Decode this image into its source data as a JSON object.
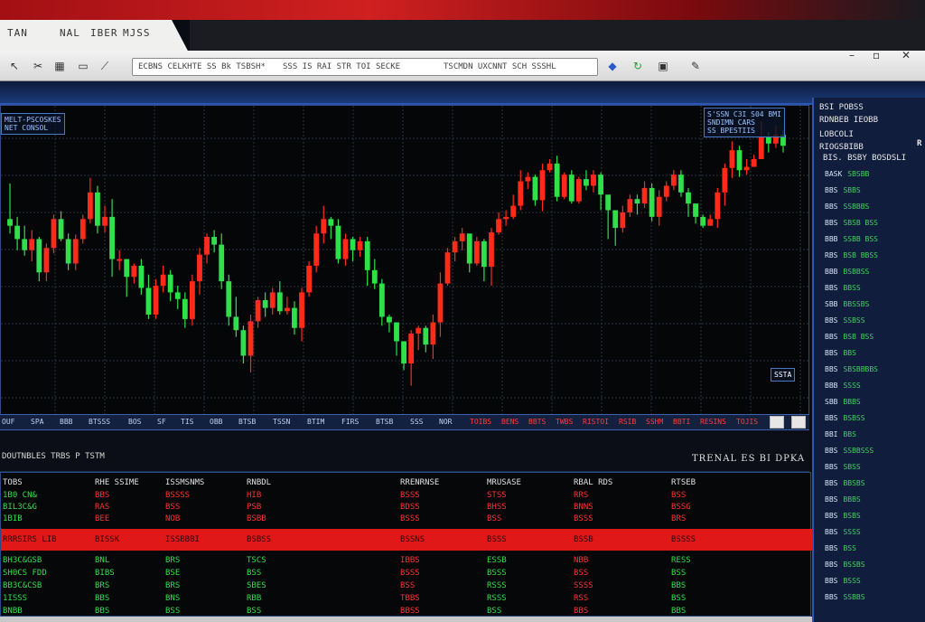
{
  "colors": {
    "up": "#2fe04a",
    "down": "#ff2a1a",
    "grid": "#2b3142",
    "accent": "#2d56b0"
  },
  "menu": {
    "items": [
      "TAN",
      "NAL",
      "IBER",
      "MJSS"
    ]
  },
  "toolbar": {
    "address_part1": "ECBNS CELKHTE SS Bk TSBSH*",
    "address_part2": "SSS IS RAI STR TOI SECKE",
    "address_part3": "TSCMDN UXCNNT SCH SSSHL",
    "icons": [
      "cursor-icon",
      "scissors-icon",
      "chart-icon",
      "image-icon",
      "line-icon",
      "bookmark-icon",
      "refresh-icon",
      "camera-icon",
      "pen-icon"
    ],
    "window_buttons": [
      "–",
      "▫",
      "✕"
    ]
  },
  "chart_data": {
    "type": "candlestick",
    "overlay_top_left": [
      "MELT-PSCOSKES",
      "NET CONSOL"
    ],
    "overlay_top_right": [
      "S'SSN C3I S04 BMI",
      "SNDIMN CARS",
      "SS BPESTIIS"
    ],
    "price_tag": "SSTA",
    "candles": [
      [
        318,
        312,
        350,
        305
      ],
      [
        312,
        300,
        320,
        290
      ],
      [
        300,
        290,
        312,
        285
      ],
      [
        290,
        300,
        308,
        280
      ],
      [
        300,
        270,
        302,
        262
      ],
      [
        270,
        292,
        296,
        262
      ],
      [
        292,
        318,
        322,
        287
      ],
      [
        318,
        300,
        325,
        298
      ],
      [
        300,
        278,
        305,
        272
      ],
      [
        278,
        300,
        304,
        272
      ],
      [
        300,
        318,
        322,
        296
      ],
      [
        318,
        342,
        355,
        314
      ],
      [
        342,
        312,
        348,
        305
      ],
      [
        312,
        320,
        330,
        306
      ],
      [
        320,
        282,
        336,
        266
      ],
      [
        282,
        282,
        290,
        272
      ],
      [
        282,
        266,
        280,
        248
      ],
      [
        266,
        276,
        278,
        260
      ],
      [
        276,
        256,
        282,
        250
      ],
      [
        256,
        232,
        268,
        228
      ],
      [
        232,
        258,
        264,
        228
      ],
      [
        258,
        268,
        276,
        252
      ],
      [
        268,
        252,
        272,
        244
      ],
      [
        252,
        246,
        258,
        237
      ],
      [
        246,
        228,
        252,
        220
      ],
      [
        228,
        262,
        268,
        222
      ],
      [
        262,
        286,
        292,
        250
      ],
      [
        286,
        302,
        305,
        278
      ],
      [
        302,
        295,
        308,
        288
      ],
      [
        295,
        262,
        305,
        255
      ],
      [
        262,
        230,
        268,
        222
      ],
      [
        230,
        218,
        248,
        212
      ],
      [
        218,
        195,
        222,
        188
      ],
      [
        195,
        226,
        232,
        180
      ],
      [
        226,
        245,
        248,
        220
      ],
      [
        245,
        238,
        252,
        230
      ],
      [
        238,
        252,
        256,
        232
      ],
      [
        252,
        235,
        262,
        232
      ],
      [
        235,
        238,
        248,
        232
      ],
      [
        238,
        220,
        244,
        214
      ],
      [
        220,
        252,
        256,
        208
      ],
      [
        252,
        276,
        280,
        248
      ],
      [
        276,
        305,
        312,
        270
      ],
      [
        305,
        318,
        330,
        296
      ],
      [
        318,
        312,
        320,
        300
      ],
      [
        312,
        282,
        318,
        278
      ],
      [
        282,
        300,
        305,
        276
      ],
      [
        300,
        290,
        302,
        280
      ],
      [
        290,
        298,
        302,
        284
      ],
      [
        298,
        272,
        302,
        258
      ],
      [
        272,
        260,
        282,
        255
      ],
      [
        260,
        230,
        264,
        222
      ],
      [
        230,
        225,
        232,
        216
      ],
      [
        225,
        208,
        212,
        195
      ],
      [
        208,
        188,
        196,
        182
      ],
      [
        188,
        215,
        218,
        168
      ],
      [
        215,
        220,
        222,
        200
      ],
      [
        220,
        205,
        222,
        198
      ],
      [
        205,
        225,
        232,
        192
      ],
      [
        225,
        260,
        270,
        212
      ],
      [
        260,
        288,
        292,
        258
      ],
      [
        288,
        298,
        302,
        280
      ],
      [
        298,
        305,
        310,
        290
      ],
      [
        305,
        278,
        300,
        270
      ],
      [
        278,
        298,
        302,
        276
      ],
      [
        298,
        275,
        300,
        262
      ],
      [
        275,
        306,
        310,
        258
      ],
      [
        306,
        318,
        324,
        304
      ],
      [
        318,
        320,
        326,
        312
      ],
      [
        320,
        330,
        340,
        318
      ],
      [
        330,
        352,
        362,
        326
      ],
      [
        352,
        356,
        360,
        345
      ],
      [
        356,
        335,
        358,
        330
      ],
      [
        335,
        362,
        368,
        325
      ],
      [
        362,
        368,
        372,
        360
      ],
      [
        368,
        338,
        375,
        334
      ],
      [
        338,
        358,
        360,
        336
      ],
      [
        358,
        334,
        362,
        332
      ],
      [
        334,
        354,
        356,
        332
      ],
      [
        354,
        348,
        362,
        344
      ],
      [
        348,
        358,
        362,
        342
      ],
      [
        358,
        340,
        360,
        326
      ],
      [
        340,
        326,
        332,
        300
      ],
      [
        326,
        310,
        318,
        294
      ],
      [
        310,
        324,
        330,
        306
      ],
      [
        324,
        336,
        340,
        320
      ],
      [
        336,
        332,
        340,
        322
      ],
      [
        332,
        346,
        352,
        328
      ],
      [
        346,
        320,
        350,
        316
      ],
      [
        320,
        338,
        344,
        312
      ],
      [
        338,
        348,
        352,
        334
      ],
      [
        348,
        358,
        362,
        344
      ],
      [
        358,
        342,
        362,
        338
      ],
      [
        342,
        332,
        346,
        320
      ],
      [
        332,
        320,
        328,
        314
      ],
      [
        320,
        312,
        322,
        310
      ],
      [
        312,
        318,
        322,
        312
      ],
      [
        318,
        342,
        346,
        310
      ],
      [
        342,
        364,
        368,
        330
      ],
      [
        364,
        380,
        388,
        355
      ],
      [
        380,
        362,
        384,
        356
      ],
      [
        362,
        365,
        372,
        358
      ],
      [
        365,
        372,
        376,
        366
      ],
      [
        372,
        392,
        406,
        372
      ],
      [
        392,
        386,
        396,
        378
      ],
      [
        386,
        394,
        402,
        382
      ],
      [
        394,
        384,
        398,
        378
      ]
    ]
  },
  "tabs": {
    "left": [
      "OUF",
      "SPA",
      "BBB",
      "BTSSS",
      "BOS",
      "SF",
      "TIS",
      "OBB",
      "BTSB",
      "TSSN",
      "BTIM",
      "FIRS",
      "BTSB",
      "SSS",
      "NOR"
    ],
    "right": [
      "TOIBS",
      "BENS",
      "BBTS",
      "TWBS",
      "RISTOI",
      "RSIB",
      "SSHM",
      "BBTI",
      "RESINS",
      "TOJIS"
    ]
  },
  "section_title": {
    "left": "DOUTNBLES TRBS P TSTM",
    "right": "TRENAL ES BI DPKA"
  },
  "table": {
    "headers": [
      "TOBS",
      "RHE SSIME",
      "ISSMSNMS",
      "RNBDL",
      "RRENRNSE",
      "MRUSASE",
      "RBAL RDS",
      "RTSEB"
    ],
    "rows_top": [
      [
        "1B0 CN&",
        "BBS",
        "BSSSS",
        "HIB",
        "BSSS",
        "STSS",
        "RRS",
        "BSS"
      ],
      [
        "BIL3C&G",
        "RAS",
        "BSS",
        "PSB",
        "BDSS",
        "BHSS",
        "BNNS",
        "BSSG"
      ],
      [
        "1BIB",
        "BEE",
        "NOB",
        "BSBB",
        "BSSS",
        "BSS",
        "BSSS",
        "BRS"
      ]
    ],
    "band_row": [
      "RRRSIRS LIB",
      "BISSK",
      "ISSBBBI",
      "BSBSS",
      "BSSNS",
      "BSSS",
      "BSSB",
      "BSSSS"
    ],
    "rows_bottom": [
      [
        "BH3C&GSB",
        "BNL",
        "BRS",
        "TSCS",
        "IBBS",
        "ESSB",
        "NBB",
        "RESS"
      ],
      [
        "SH0CS FDD",
        "BIBS",
        "BSE",
        "BSS",
        "BSSS",
        "BSSS",
        "BSS",
        "BSS"
      ],
      [
        "BB3C&CSB",
        "BRS",
        "BRS",
        "SBES",
        "BSS",
        "RSSS",
        "SSSS",
        "BBS"
      ],
      [
        "1ISSS",
        "BBS",
        "BNS",
        "RBB",
        "TBBS",
        "RSSS",
        "RSS",
        "BSS"
      ],
      [
        "BNBB",
        "BBS",
        "BSS",
        "BSS",
        "BBSS",
        "BSS",
        "BBS",
        "BBS"
      ]
    ]
  },
  "side": {
    "headers": [
      "BSI POBSS",
      "RDNBEB IEOBB",
      "LOBCOLI",
      "RIOGSBIBB",
      "BIS. BSBY BOSDSLI"
    ],
    "marker": "R",
    "rows": [
      [
        "BASK",
        "SBSBB"
      ],
      [
        "BBS",
        "SBBS"
      ],
      [
        "BBS",
        "SSBBBS"
      ],
      [
        "BBS",
        "SBSB BSS"
      ],
      [
        "BBB",
        "SSBB BSS"
      ],
      [
        "RBS",
        "BSB BBSS"
      ],
      [
        "BBB",
        "BSBBSS"
      ],
      [
        "BBS",
        "BBSS"
      ],
      [
        "SBB",
        "BBSSBS"
      ],
      [
        "BBS",
        "SSBSS"
      ],
      [
        "BBS",
        "BSB BSS"
      ],
      [
        "BBS",
        "BBS"
      ],
      [
        "BBS",
        "SBSBBBBS"
      ],
      [
        "BBB",
        "SSSS"
      ],
      [
        "SBB",
        "BBBS"
      ],
      [
        "BBS",
        "BSBSS"
      ],
      [
        "BBI",
        "BBS"
      ],
      [
        "BBS",
        "SSBBSSS"
      ],
      [
        "BBS",
        "SBSS"
      ],
      [
        "BBS",
        "BBSBS"
      ],
      [
        "BBS",
        "BBBS"
      ],
      [
        "BBS",
        "BSBS"
      ],
      [
        "BBS",
        "SSSS"
      ],
      [
        "BBS",
        "BSS"
      ],
      [
        "BBS",
        "BSSBS"
      ],
      [
        "BBS",
        "BSSS"
      ],
      [
        "BBS",
        "SSBBS"
      ]
    ]
  }
}
